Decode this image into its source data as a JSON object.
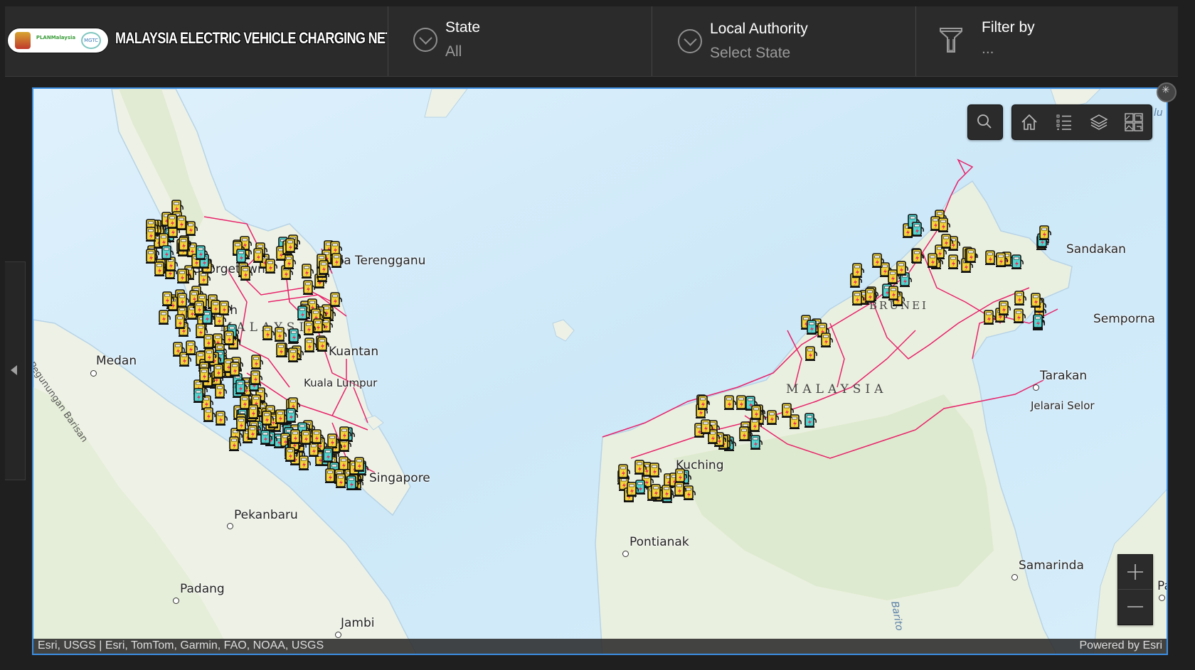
{
  "header": {
    "logo_alt": "PLANMalaysia MGTC",
    "logo_texts": {
      "plan": "PLANMalaysia",
      "mgtc": "MGTC"
    },
    "title": "MALAYSIA ELECTRIC VEHICLE CHARGING NETWORK"
  },
  "selectors": [
    {
      "label": "State",
      "value": "All",
      "icon": "chevron-down-circle-icon"
    },
    {
      "label": "Local Authority",
      "value": "Select State",
      "icon": "chevron-down-circle-icon"
    },
    {
      "label": "Filter by",
      "value": "...",
      "icon": "funnel-icon"
    }
  ],
  "map": {
    "toolbar": {
      "search": "search-icon",
      "tools": [
        "home-icon",
        "legend-icon",
        "layers-icon",
        "basemap-gallery-icon"
      ]
    },
    "zoom": {
      "in": "+",
      "out": "−"
    },
    "attribution": "Esri, USGS | Esri, TomTom, Garmin, FAO, NOAA, USGS",
    "powered_by": "Powered by Esri",
    "labels": {
      "cities": [
        "Kuala Terengganu",
        "Kuantan",
        "Medan",
        "Pekanbaru",
        "Padang",
        "Jambi",
        "Pontianak",
        "Samarinda",
        "Tarakan",
        "Jelarai Selor",
        "Sandakan",
        "Semporna",
        "Kuching",
        "Singapore",
        "Ipoh",
        "Georgetown",
        "Kuala Lumpur",
        "Pa"
      ],
      "countries": [
        "MALAYSIA",
        "MALAYSIA",
        "BRUNEI"
      ],
      "features": [
        "Pegunungan Barisan",
        "Barito",
        "lu"
      ]
    },
    "marker_colors": {
      "standard": "#f2d43a",
      "fast": "#4fd6d0",
      "bolt": "#e8315b",
      "boundary": "#e8226a"
    }
  }
}
